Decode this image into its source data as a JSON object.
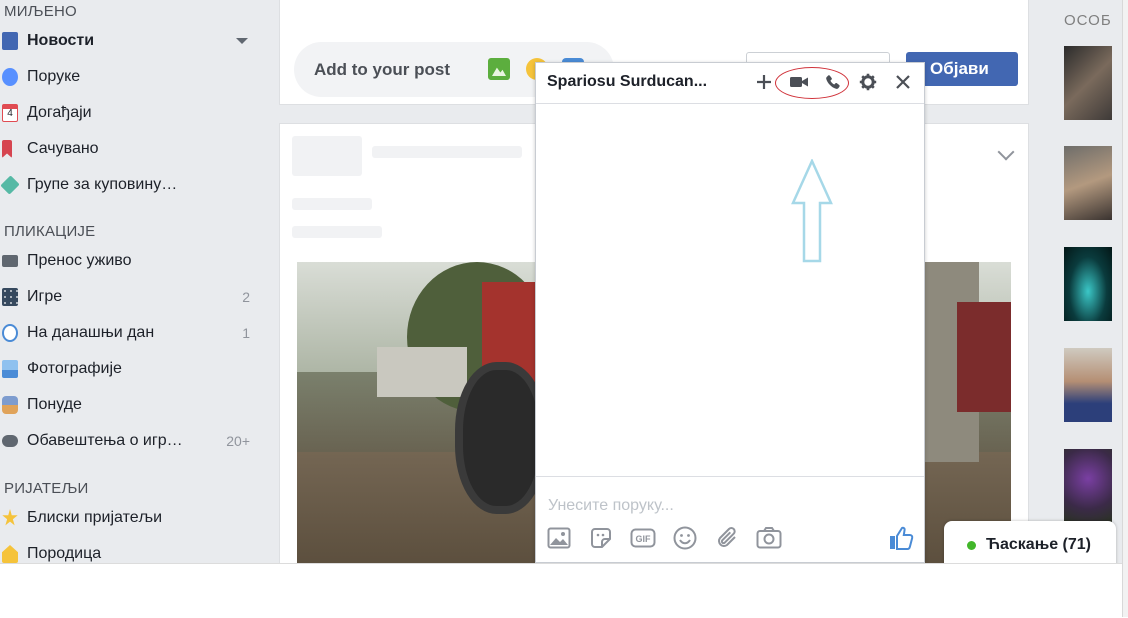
{
  "sidebar": {
    "sections": {
      "favorites": "МИЉЕНО",
      "apps": "ПЛИКАЦИЈЕ",
      "friends": "РИЈАТЕЉИ"
    },
    "favorites_items": [
      {
        "label": "Новости",
        "icon": "news-feed-icon",
        "color": "#4267b2"
      },
      {
        "label": "Поруке",
        "icon": "messenger-icon",
        "color": "#5890ff"
      },
      {
        "label": "Догађаји",
        "icon": "calendar-icon",
        "color": "#e04b52"
      },
      {
        "label": "Сачувано",
        "icon": "bookmark-icon",
        "color": "#d64550"
      },
      {
        "label": "Групе за куповину…",
        "icon": "tag-icon",
        "color": "#56b9a5"
      }
    ],
    "apps_items": [
      {
        "label": "Пренос уживо",
        "count": "",
        "icon": "video-camera-icon",
        "color": "#606770"
      },
      {
        "label": "Игре",
        "count": "2",
        "icon": "dice-icon",
        "color": "#36495e"
      },
      {
        "label": "На данашњи дан",
        "count": "1",
        "icon": "clock-icon",
        "color": "#4a8bd6"
      },
      {
        "label": "Фотографије",
        "count": "",
        "icon": "photo-icon",
        "color": "#4a8bd6"
      },
      {
        "label": "Понуде",
        "count": "",
        "icon": "offer-icon",
        "color": "#7d9ccf"
      },
      {
        "label": "Обавештења о игр…",
        "count": "20+",
        "icon": "gamepad-icon",
        "color": "#606770"
      }
    ],
    "friends_items": [
      {
        "label": "Блиски пријатељи",
        "icon": "star-icon",
        "color": "#f5c33b"
      },
      {
        "label": "Породица",
        "icon": "family-icon",
        "color": "#f5c33b"
      }
    ]
  },
  "composer": {
    "add_to_post": "Add to your post",
    "post_button": "Објави"
  },
  "chat_window": {
    "title": "Spariosu Surducan...",
    "input_placeholder": "Унесите поруку...",
    "header_icons": [
      "plus-icon",
      "video-call-icon",
      "voice-call-icon",
      "gear-icon",
      "close-icon"
    ],
    "toolbar_icons": [
      "photo-icon",
      "sticker-icon",
      "gif-icon",
      "emoji-icon",
      "attachment-icon",
      "camera-icon",
      "thumbs-up-icon"
    ],
    "gif_label": "GIF"
  },
  "right_rail": {
    "header": "ОСОБ",
    "contacts": [
      "avatar-1",
      "avatar-2",
      "avatar-3",
      "avatar-4",
      "avatar-5"
    ]
  },
  "chat_bar": {
    "label": "Ћаскање (71)",
    "status_color": "#42b72a"
  },
  "colors": {
    "primary": "#4267b2",
    "messenger_blue": "#0084ff",
    "annotation_red": "#d0323a",
    "annotation_arrow": "#a6d8e8"
  }
}
